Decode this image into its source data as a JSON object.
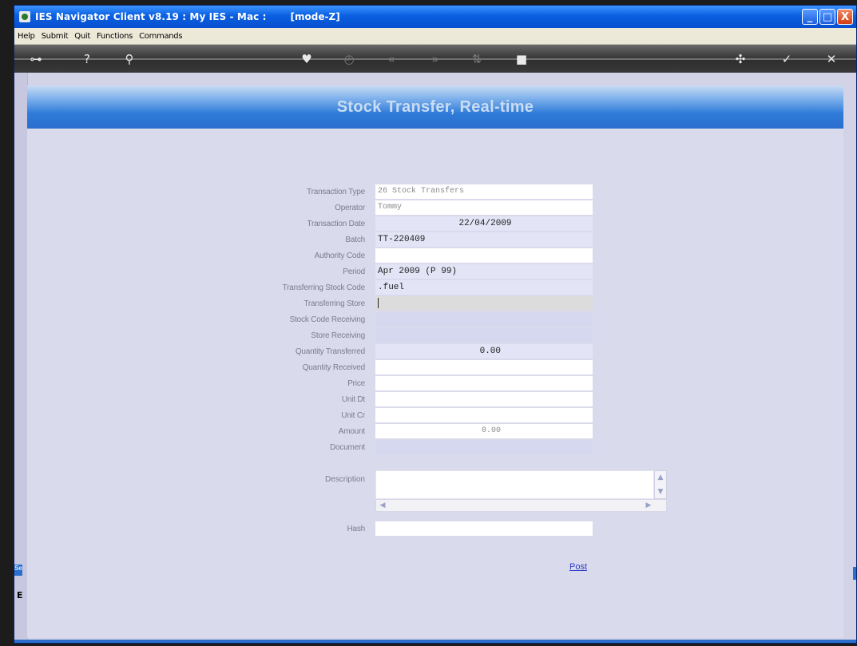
{
  "window": {
    "title": "IES Navigator Client v8.19 : My IES - Mac :",
    "mode": "[mode-Z]",
    "controls": {
      "minimize": "_",
      "maximize": "□",
      "close": "X"
    }
  },
  "menu": [
    "Help",
    "Submit",
    "Quit",
    "Functions",
    "Commands"
  ],
  "toolbar": {
    "icons": [
      {
        "name": "key-icon",
        "glyph": "⊶",
        "dim": false
      },
      {
        "name": "help-icon",
        "glyph": "?",
        "dim": false
      },
      {
        "name": "search-icon",
        "glyph": "⚲",
        "dim": false
      },
      {
        "name": "heart-icon",
        "glyph": "♥",
        "dim": false
      },
      {
        "name": "clock-icon",
        "glyph": "◴",
        "dim": true
      },
      {
        "name": "rewind-icon",
        "glyph": "«",
        "dim": true
      },
      {
        "name": "fast-forward-icon",
        "glyph": "»",
        "dim": true
      },
      {
        "name": "up-down-icon",
        "glyph": "⇅",
        "dim": true
      },
      {
        "name": "stop-icon",
        "glyph": "■",
        "dim": false
      },
      {
        "name": "target-icon",
        "glyph": "✣",
        "dim": false
      },
      {
        "name": "check-icon",
        "glyph": "✓",
        "dim": false
      },
      {
        "name": "close-icon",
        "glyph": "✕",
        "dim": false
      }
    ]
  },
  "page": {
    "title": "Stock Transfer, Real-time"
  },
  "form": {
    "fields": [
      {
        "label": "Transaction Type",
        "value": "26 Stock Transfers"
      },
      {
        "label": "Operator",
        "value": "Tommy"
      },
      {
        "label": "Transaction Date",
        "value": "22/04/2009"
      },
      {
        "label": "Batch",
        "value": "TT-220409"
      },
      {
        "label": "Authority Code",
        "value": ""
      },
      {
        "label": "Period",
        "value": "Apr 2009 (P 99)"
      },
      {
        "label": "Transferring Stock Code",
        "value": ".fuel"
      },
      {
        "label": "Transferring Store",
        "value": ""
      },
      {
        "label": "Stock Code Receiving",
        "value": ""
      },
      {
        "label": "Store Receiving",
        "value": ""
      },
      {
        "label": "Quantity Transferred",
        "value": "0.00"
      },
      {
        "label": "Quantity Received",
        "value": ""
      },
      {
        "label": "Price",
        "value": ""
      },
      {
        "label": "Unit Dt",
        "value": ""
      },
      {
        "label": "Unit Cr",
        "value": ""
      },
      {
        "label": "Amount",
        "value": "0.00"
      },
      {
        "label": "Document",
        "value": ""
      }
    ],
    "description_label": "Description",
    "hash_label": "Hash",
    "post_label": "Post"
  },
  "sidebar": {
    "tab_label": "Se",
    "box_label": "E"
  }
}
